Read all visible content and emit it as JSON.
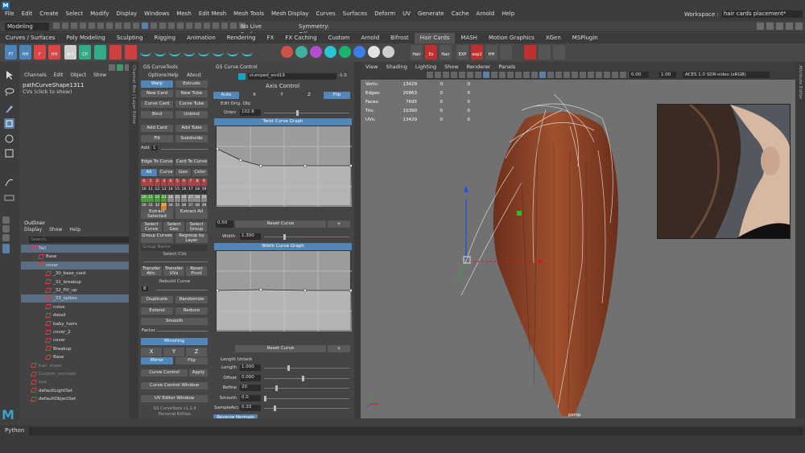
{
  "menubar": {
    "logo": "M",
    "items": [
      "File",
      "Edit",
      "Create",
      "Select",
      "Modify",
      "Display",
      "Windows",
      "Mesh",
      "Edit Mesh",
      "Mesh Tools",
      "Mesh Display",
      "Curves",
      "Surfaces",
      "Deform",
      "UV",
      "Generate",
      "Cache",
      "Arnold",
      "Help"
    ],
    "workspace_label": "Workspace :",
    "workspace_value": "hair cards placement*"
  },
  "statusline": {
    "mode": "Modeling",
    "live_surface": "No Live Surface",
    "symmetry": "Symmetry: Off"
  },
  "shelf": {
    "tabs": [
      "Curves / Surfaces",
      "Poly Modeling",
      "Sculpting",
      "Rigging",
      "Animation",
      "Rendering",
      "FX",
      "FX Caching",
      "Custom",
      "Arnold",
      "Bifrost",
      "Hair Cards",
      "MASH",
      "Motion Graphics",
      "XGen",
      "MSPlugin"
    ],
    "active_tab": "Hair Cards",
    "labels": [
      "FT",
      "HH",
      "F",
      "HH",
      "4-4",
      "CP",
      "Hair",
      "Ex",
      "Hair",
      "EXP",
      "exp2",
      "HH"
    ],
    "colors": [
      "#d0504a",
      "#3fb19c",
      "#b44bd0",
      "#27c6d6",
      "#1ab46f",
      "#3b7ee8",
      "#e2e2e2",
      "#cfcfcf"
    ]
  },
  "channel": {
    "menu": [
      "Channels",
      "Edit",
      "Object",
      "Show"
    ],
    "node": "pathCurveShape1311",
    "cvs": "CVs (click to show)"
  },
  "outliner": {
    "title": "Outliner",
    "menu": [
      "Display",
      "Show",
      "Help"
    ],
    "search_placeholder": "Search...",
    "items": [
      {
        "label": "Tail",
        "indent": 1,
        "state": "sel"
      },
      {
        "label": "Base",
        "indent": 2,
        "state": ""
      },
      {
        "label": "cover",
        "indent": 2,
        "state": "sel"
      },
      {
        "label": "_30_base_card",
        "indent": 3,
        "state": ""
      },
      {
        "label": "_31_breakup",
        "indent": 3,
        "state": ""
      },
      {
        "label": "_32_Fill_up",
        "indent": 3,
        "state": ""
      },
      {
        "label": "_33_spikes",
        "indent": 3,
        "state": "sel"
      },
      {
        "label": "noise",
        "indent": 3,
        "state": ""
      },
      {
        "label": "detail",
        "indent": 3,
        "state": ""
      },
      {
        "label": "baby_hairs",
        "indent": 3,
        "state": ""
      },
      {
        "label": "cover_2",
        "indent": 3,
        "state": ""
      },
      {
        "label": "cover",
        "indent": 3,
        "state": ""
      },
      {
        "label": "Breakup",
        "indent": 3,
        "state": ""
      },
      {
        "label": "Base",
        "indent": 3,
        "state": ""
      },
      {
        "label": "hair_sheet",
        "indent": 1,
        "state": "dim"
      },
      {
        "label": "Custom_normals",
        "indent": 1,
        "state": "dim"
      },
      {
        "label": "eye",
        "indent": 1,
        "state": "dim"
      },
      {
        "label": "defaultLightSet",
        "indent": 1,
        "state": ""
      },
      {
        "label": "defaultObjectSet",
        "indent": 1,
        "state": ""
      }
    ]
  },
  "side_label": "Channel Box / Layer Editor",
  "gs_tools": {
    "title": "GS CurveTools",
    "menu": [
      "Options",
      "Help",
      "About"
    ],
    "buttons": {
      "warp": "Warp",
      "extrude": "Extrude",
      "new_card": "New Card",
      "new_tube": "New Tube",
      "curve_card": "Curve Card",
      "curve_tube": "Curve Tube",
      "bind": "Bind",
      "unbind": "Unbind",
      "add_card": "Add Card",
      "add_tube": "Add Tube",
      "fill": "Fill",
      "subdivide": "Subdivide",
      "add": "Add",
      "add_value": "1",
      "edge_to_curve": "Edge To Curve",
      "card_to_curve": "Card To Curve",
      "all": "All",
      "curve": "Curve",
      "geo": "Geo",
      "color": "Color",
      "extract_selected": "Extract Selected",
      "extract_all": "Extract All",
      "select_curve": "Select Curve",
      "select_geo": "Select Geo",
      "select_group": "Select Group",
      "group_curves": "Group Curves",
      "regroup_layer": "Regroup by Layer",
      "group_name_placeholder": "Group Name",
      "select_cvs": "Select CVs",
      "transfer_attr": "Transfer Attr.",
      "transfer_uvs": "Transfer UVs",
      "reset_pivot": "Reset Pivot",
      "rebuild_curve": "Rebuild Curve",
      "rebuild_value": "8",
      "duplicate": "Duplicate",
      "randomize": "Randomize",
      "extend": "Extend",
      "reduce": "Reduce",
      "smooth": "Smooth",
      "factor": "Factor",
      "mirroring": "Mirroring",
      "x": "X",
      "y": "Y",
      "z": "Z",
      "mirror": "Mirror",
      "flip": "Flip",
      "curve_control": "Curve Control",
      "apply": "Apply",
      "curve_control_window": "Curve Control Window",
      "uv_editor_window": "UV Editor Window"
    },
    "layers": [
      "0",
      "1",
      "2",
      "3",
      "4",
      "5",
      "6",
      "7",
      "8",
      "9",
      "10",
      "11",
      "12",
      "13",
      "14",
      "15",
      "16",
      "17",
      "18",
      "19",
      "20",
      "21",
      "22",
      "23",
      "24",
      "25",
      "26",
      "27",
      "28",
      "29",
      "30",
      "31",
      "32",
      "33",
      "34",
      "35",
      "36",
      "37",
      "38",
      "39"
    ],
    "version": "GS CurveTools v1.2.4",
    "edition": "Personal Edition"
  },
  "gs_control": {
    "title": "GS Curve Control",
    "field_value": "clumped_end19",
    "number": "-1.0",
    "axis_control": "Axis Control",
    "auto": "Auto",
    "x": "X",
    "y": "Y",
    "z": "Z",
    "flip": "Flip",
    "edit_orig": "Edit Orig. Obj",
    "orient_label": "Orien",
    "orient_value": "102.8",
    "twist_graph": "Twist Curve Graph",
    "twist_value": "0.50",
    "reset_curve": "Reset Curve",
    "width_label": "Width",
    "width_value": "1.300",
    "width_graph": "Width Curve Graph",
    "reset_curve2": "Reset Curve",
    "length_unlock": "Length Unlock",
    "sliders": [
      {
        "label": "Length",
        "value": "1.000"
      },
      {
        "label": "Offset",
        "value": "0.000"
      },
      {
        "label": "Refine",
        "value": "20"
      },
      {
        "label": "Smooth",
        "value": "0.0"
      },
      {
        "label": "SampleAcc",
        "value": "0.33"
      }
    ],
    "reverse_normals": "Reverse Normals"
  },
  "viewport": {
    "menu": [
      "View",
      "Shading",
      "Lighting",
      "Show",
      "Renderer",
      "Panels"
    ],
    "exposure": "0.00",
    "gamma": "1.00",
    "colorspace": "ACES 1.0 SDR-video (sRGB)",
    "hud": [
      {
        "k": "Verts:",
        "a": "13429",
        "b": "0",
        "c": "0"
      },
      {
        "k": "Edges:",
        "a": "20863",
        "b": "0",
        "c": "0"
      },
      {
        "k": "Faces:",
        "a": "7695",
        "b": "0",
        "c": "0"
      },
      {
        "k": "Tris:",
        "a": "15390",
        "b": "0",
        "c": "0"
      },
      {
        "k": "UVs:",
        "a": "13429",
        "b": "0",
        "c": "0"
      }
    ],
    "camera": "persp",
    "right_label": "Attribute Editor"
  },
  "python": {
    "label": "Python"
  }
}
